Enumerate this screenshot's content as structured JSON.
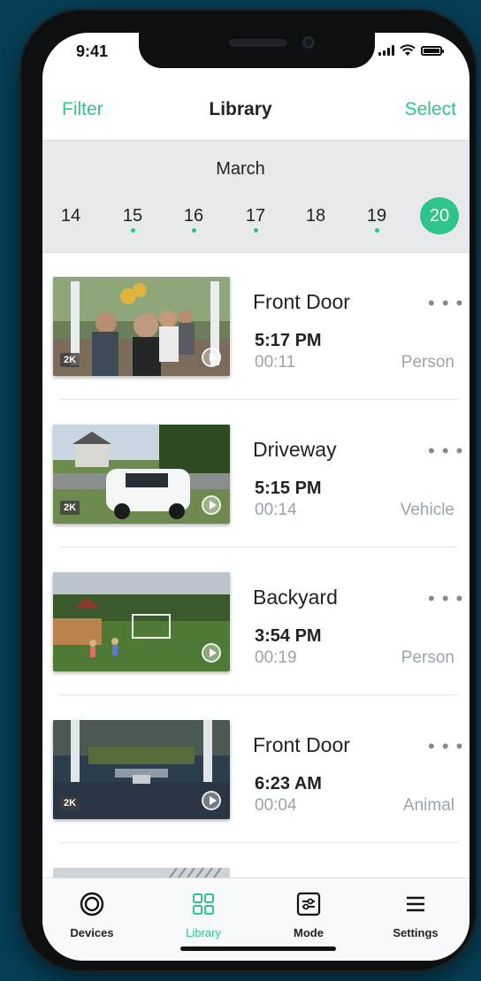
{
  "status": {
    "time": "9:41"
  },
  "header": {
    "filter_label": "Filter",
    "title": "Library",
    "select_label": "Select"
  },
  "calendar": {
    "month": "March",
    "days": [
      "14",
      "15",
      "16",
      "17",
      "18",
      "19"
    ],
    "selected_day": "20"
  },
  "events": [
    {
      "device": "Front Door",
      "time": "5:17 PM",
      "duration": "00:11",
      "type": "Person",
      "badge": "2K",
      "more": "• • •"
    },
    {
      "device": "Driveway",
      "time": "5:15 PM",
      "duration": "00:14",
      "type": "Vehicle",
      "badge": "2K",
      "more": "• • •"
    },
    {
      "device": "Backyard",
      "time": "3:54 PM",
      "duration": "00:19",
      "type": "Person",
      "badge": "",
      "more": "• • •"
    },
    {
      "device": "Front Door",
      "time": "6:23 AM",
      "duration": "00:04",
      "type": "Animal",
      "badge": "2K",
      "more": "• • •"
    }
  ],
  "tabs": [
    {
      "label": "Devices",
      "icon": "devices-icon"
    },
    {
      "label": "Library",
      "icon": "grid-icon"
    },
    {
      "label": "Mode",
      "icon": "sliders-icon"
    },
    {
      "label": "Settings",
      "icon": "menu-icon"
    }
  ],
  "colors": {
    "accent": "#2ec48a",
    "background": "#073f57"
  }
}
